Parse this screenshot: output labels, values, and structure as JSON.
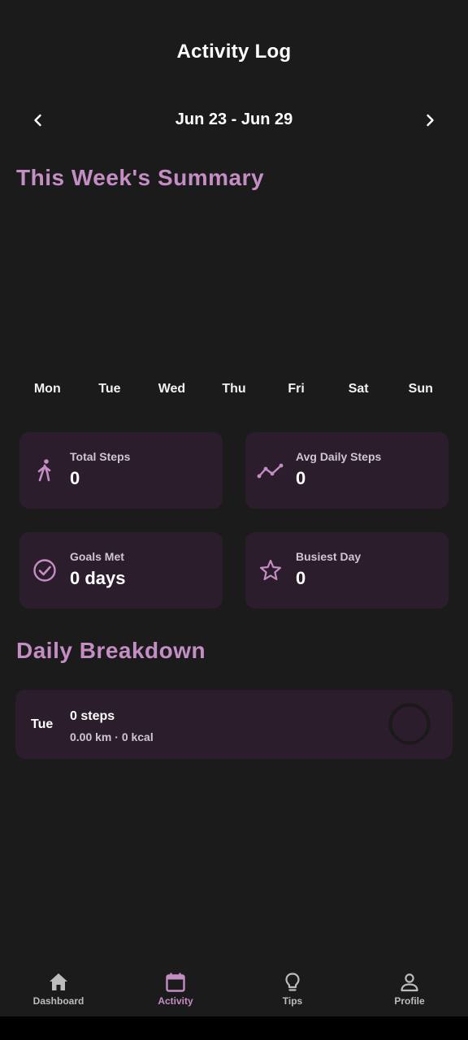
{
  "header": {
    "title": "Activity Log"
  },
  "week_nav": {
    "range": "Jun 23 - Jun 29",
    "prev_icon": "chevron-left-icon",
    "next_icon": "chevron-right-icon"
  },
  "summary": {
    "heading": "This Week's Summary",
    "days": [
      "Mon",
      "Tue",
      "Wed",
      "Thu",
      "Fri",
      "Sat",
      "Sun"
    ]
  },
  "chart_data": {
    "type": "bar",
    "categories": [
      "Mon",
      "Tue",
      "Wed",
      "Thu",
      "Fri",
      "Sat",
      "Sun"
    ],
    "values": [
      0,
      0,
      0,
      0,
      0,
      0,
      0
    ],
    "title": "",
    "xlabel": "",
    "ylabel": ""
  },
  "stats": [
    {
      "label": "Total Steps",
      "value": "0",
      "icon": "walking-icon"
    },
    {
      "label": "Avg Daily Steps",
      "value": "0",
      "icon": "trend-line-icon"
    },
    {
      "label": "Goals Met",
      "value": "0 days",
      "icon": "check-circle-icon"
    },
    {
      "label": "Busiest Day",
      "value": "0",
      "icon": "star-icon"
    }
  ],
  "breakdown": {
    "heading": "Daily Breakdown",
    "rows": [
      {
        "day": "Tue",
        "steps": "0 steps",
        "meta": "0.00 km · 0 kcal",
        "progress": 0
      }
    ]
  },
  "bottom_nav": [
    {
      "label": "Dashboard",
      "icon": "home-icon",
      "active": false
    },
    {
      "label": "Activity",
      "icon": "calendar-icon",
      "active": true
    },
    {
      "label": "Tips",
      "icon": "lightbulb-icon",
      "active": false
    },
    {
      "label": "Profile",
      "icon": "person-icon",
      "active": false
    }
  ],
  "colors": {
    "background": "#1b1b1b",
    "accent": "#c48dc4",
    "card": "#2c1d2c"
  }
}
